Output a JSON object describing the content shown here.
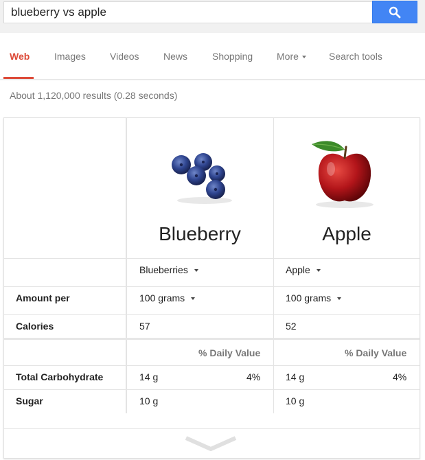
{
  "search": {
    "query": "blueberry vs apple"
  },
  "tabs": [
    {
      "label": "Web"
    },
    {
      "label": "Images"
    },
    {
      "label": "Videos"
    },
    {
      "label": "News"
    },
    {
      "label": "Shopping"
    },
    {
      "label": "More"
    },
    {
      "label": "Search tools"
    }
  ],
  "result_stats": "About 1,120,000 results (0.28 seconds)",
  "comparison": {
    "foods": [
      {
        "name": "Blueberry",
        "variety": "Blueberries",
        "amount": "100 grams",
        "calories": "57",
        "carb_g": "14 g",
        "carb_dv": "4%",
        "sugar_g": "10 g"
      },
      {
        "name": "Apple",
        "variety": "Apple",
        "amount": "100 grams",
        "calories": "52",
        "carb_g": "14 g",
        "carb_dv": "4%",
        "sugar_g": "10 g"
      }
    ],
    "rows": {
      "amount_per": "Amount per",
      "calories": "Calories",
      "total_carbohydrate": "Total Carbohydrate",
      "sugar": "Sugar"
    },
    "daily_value_header": "% Daily Value"
  },
  "colors": {
    "accent": "#dd4b39",
    "search_button": "#4285f4"
  }
}
